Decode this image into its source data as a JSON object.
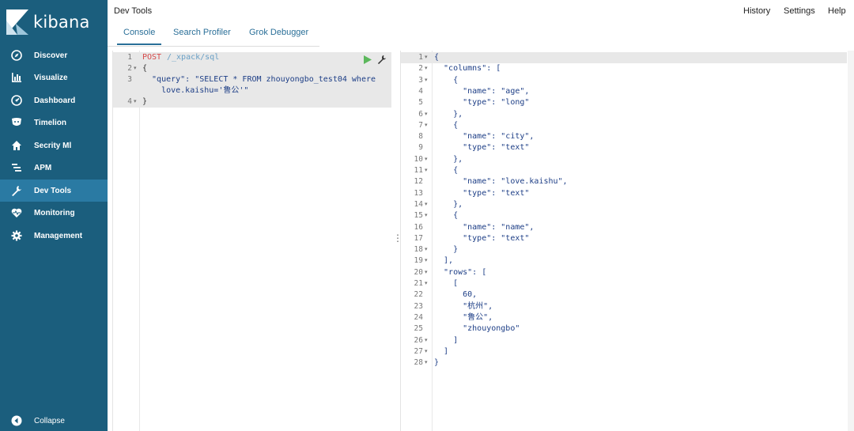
{
  "brand": {
    "name": "kibana"
  },
  "nav": {
    "items": [
      {
        "label": "Discover",
        "icon": "compass-icon"
      },
      {
        "label": "Visualize",
        "icon": "bar-chart-icon"
      },
      {
        "label": "Dashboard",
        "icon": "dashboard-icon"
      },
      {
        "label": "Timelion",
        "icon": "shield-icon"
      },
      {
        "label": "Secrity Ml",
        "icon": "home-icon"
      },
      {
        "label": "APM",
        "icon": "list-icon"
      },
      {
        "label": "Dev Tools",
        "icon": "wrench-icon",
        "active": true
      },
      {
        "label": "Monitoring",
        "icon": "heartbeat-icon"
      },
      {
        "label": "Management",
        "icon": "gear-icon"
      }
    ],
    "collapse_label": "Collapse"
  },
  "header": {
    "title": "Dev Tools",
    "links": [
      "History",
      "Settings",
      "Help"
    ],
    "tabs": [
      "Console",
      "Search Profiler",
      "Grok Debugger"
    ],
    "active_tab": "Console"
  },
  "request": {
    "method": "POST",
    "path": "/_xpack/sql",
    "line_numbers": [
      "1",
      "2",
      "3",
      "4"
    ],
    "lines": [
      "{",
      "  \"query\": \"SELECT * FROM zhouyongbo_test04 where",
      "    love.kaishu='鲁公'\"",
      "}"
    ]
  },
  "response": {
    "line_numbers": [
      "1",
      "2",
      "3",
      "4",
      "5",
      "6",
      "7",
      "8",
      "9",
      "10",
      "11",
      "12",
      "13",
      "14",
      "15",
      "16",
      "17",
      "18",
      "19",
      "20",
      "21",
      "22",
      "23",
      "24",
      "25",
      "26",
      "27",
      "28"
    ],
    "lines": [
      "{",
      "  \"columns\": [",
      "    {",
      "      \"name\": \"age\",",
      "      \"type\": \"long\"",
      "    },",
      "    {",
      "      \"name\": \"city\",",
      "      \"type\": \"text\"",
      "    },",
      "    {",
      "      \"name\": \"love.kaishu\",",
      "      \"type\": \"text\"",
      "    },",
      "    {",
      "      \"name\": \"name\",",
      "      \"type\": \"text\"",
      "    }",
      "  ],",
      "  \"rows\": [",
      "    [",
      "      60,",
      "      \"杭州\",",
      "      \"鲁公\",",
      "      \"zhouyongbo\"",
      "    ]",
      "  ]",
      "}"
    ]
  }
}
